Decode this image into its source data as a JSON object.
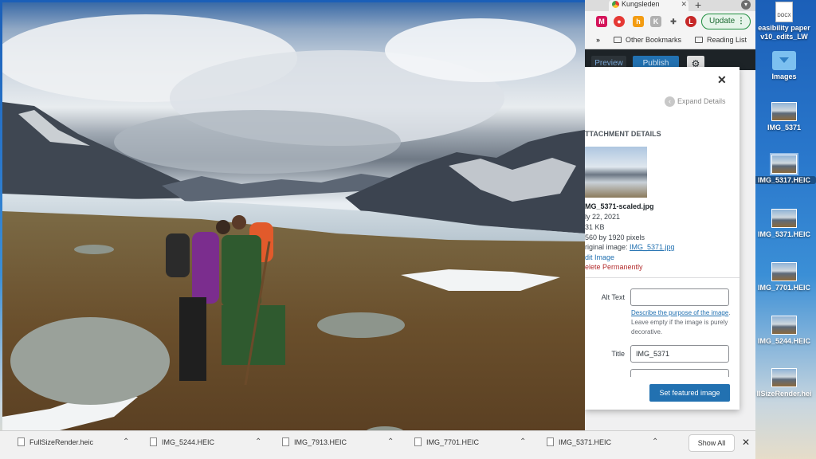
{
  "browser": {
    "tab_title": "Kungsleden",
    "update_label": "Update",
    "bookmarks": {
      "chevron": "»",
      "other": "Other Bookmarks",
      "reading_list": "Reading List"
    },
    "wp_toolbar": {
      "preview": "Preview",
      "publish": "Publish"
    }
  },
  "modal": {
    "expand_label": "Expand Details",
    "heading": "TTACHMENT DETAILS",
    "filename": "MG_5371-scaled.jpg",
    "date": "ly 22, 2021",
    "size": "31 KB",
    "dimensions": "560 by 1920 pixels",
    "original_prefix": "riginal image: ",
    "original_link": "IMG_5371.jpg",
    "edit": "dit Image",
    "delete": "elete Permanently",
    "alt_text_label": "Alt Text",
    "alt_text_value": "",
    "desc_link": "Describe the purpose of the image",
    "desc_rest": ". Leave empty if the image is purely decorative.",
    "title_label": "Title",
    "title_value": "IMG_5371",
    "set_featured": "Set featured image"
  },
  "desktop": {
    "items": [
      {
        "label": "easibility paper",
        "label2": "v10_edits_LW"
      },
      {
        "label": "Images"
      },
      {
        "label": "IMG_5371"
      },
      {
        "label": "IMG_5317.HEIC"
      },
      {
        "label": "IMG_5371.HEIC"
      },
      {
        "label": "IMG_7701.HEIC"
      },
      {
        "label": "IMG_5244.HEIC"
      },
      {
        "label": "llSizeRender.hei"
      }
    ]
  },
  "downloads": {
    "items": [
      "FullSizeRender.heic",
      "IMG_5244.HEIC",
      "IMG_7913.HEIC",
      "IMG_7701.HEIC",
      "IMG_5371.HEIC"
    ],
    "show_all": "Show All"
  },
  "colors": {
    "wp_blue": "#2271b1",
    "delete_red": "#b32d2e",
    "update_green": "#1e8e3e"
  }
}
